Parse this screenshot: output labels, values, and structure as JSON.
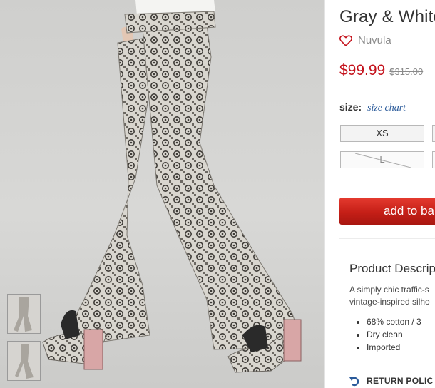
{
  "product": {
    "title": "Gray & White",
    "brand": "Nuvula",
    "price": "$99.99",
    "old_price": "$315.00"
  },
  "sizes": {
    "label": "size:",
    "chart_link": "size chart",
    "options": [
      {
        "label": "XS",
        "available": true
      },
      {
        "label": "L",
        "available": false
      }
    ]
  },
  "cart": {
    "add_label": "add to ba"
  },
  "description": {
    "title": "Product Descrip",
    "line1": "A simply chic traffic-s",
    "line2": "vintage-inspired silho",
    "bullets": [
      "68% cotton / 3",
      "Dry clean",
      "Imported"
    ]
  },
  "return_policy": {
    "label": "RETURN POLIC"
  },
  "colors": {
    "price": "#c4121c",
    "cart_button": "#c51f17",
    "link": "#2a5a9a"
  },
  "icons": {
    "wishlist": "heart-outline-icon",
    "return": "return-arrow-icon"
  }
}
